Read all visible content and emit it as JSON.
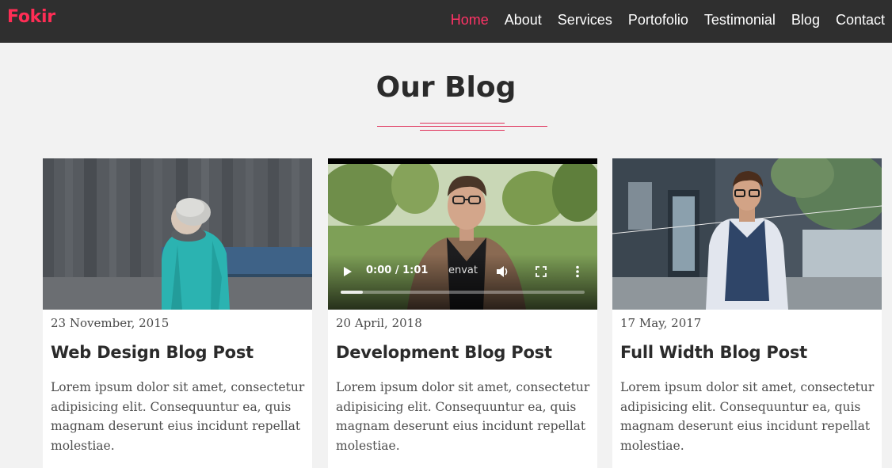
{
  "brand": {
    "name": "Fokir",
    "color": "#ff2d55"
  },
  "nav": {
    "items": [
      {
        "label": "Home",
        "active": true
      },
      {
        "label": "About",
        "active": false
      },
      {
        "label": "Services",
        "active": false
      },
      {
        "label": "Portofolio",
        "active": false
      },
      {
        "label": "Testimonial",
        "active": false
      },
      {
        "label": "Blog",
        "active": false
      },
      {
        "label": "Contact",
        "active": false
      }
    ],
    "active_color": "#ff3366"
  },
  "section": {
    "title": "Our Blog",
    "accent_color": "#e0325a"
  },
  "posts": [
    {
      "media": "image",
      "media_name": "woman-in-teal-jacket-photo",
      "date": "23 November, 2015",
      "title": "Web Design Blog Post",
      "text": "Lorem ipsum dolor sit amet, consectetur adipisicing elit. Consequuntur ea, quis magnam deserunt eius incidunt repellat molestiae."
    },
    {
      "media": "video",
      "media_name": "man-talking-video",
      "date": "20 April, 2018",
      "title": "Development Blog Post",
      "text": "Lorem ipsum dolor sit amet, consectetur adipisicing elit. Consequuntur ea, quis magnam deserunt eius incidunt repellat molestiae.",
      "video": {
        "time": "0:00 / 1:01",
        "progress": 0.09,
        "watermark": "envat"
      }
    },
    {
      "media": "image",
      "media_name": "man-in-vest-street-photo",
      "date": "17 May, 2017",
      "title": "Full Width Blog Post",
      "text": "Lorem ipsum dolor sit amet, consectetur adipisicing elit. Consequuntur ea, quis magnam deserunt eius incidunt repellat molestiae."
    }
  ]
}
